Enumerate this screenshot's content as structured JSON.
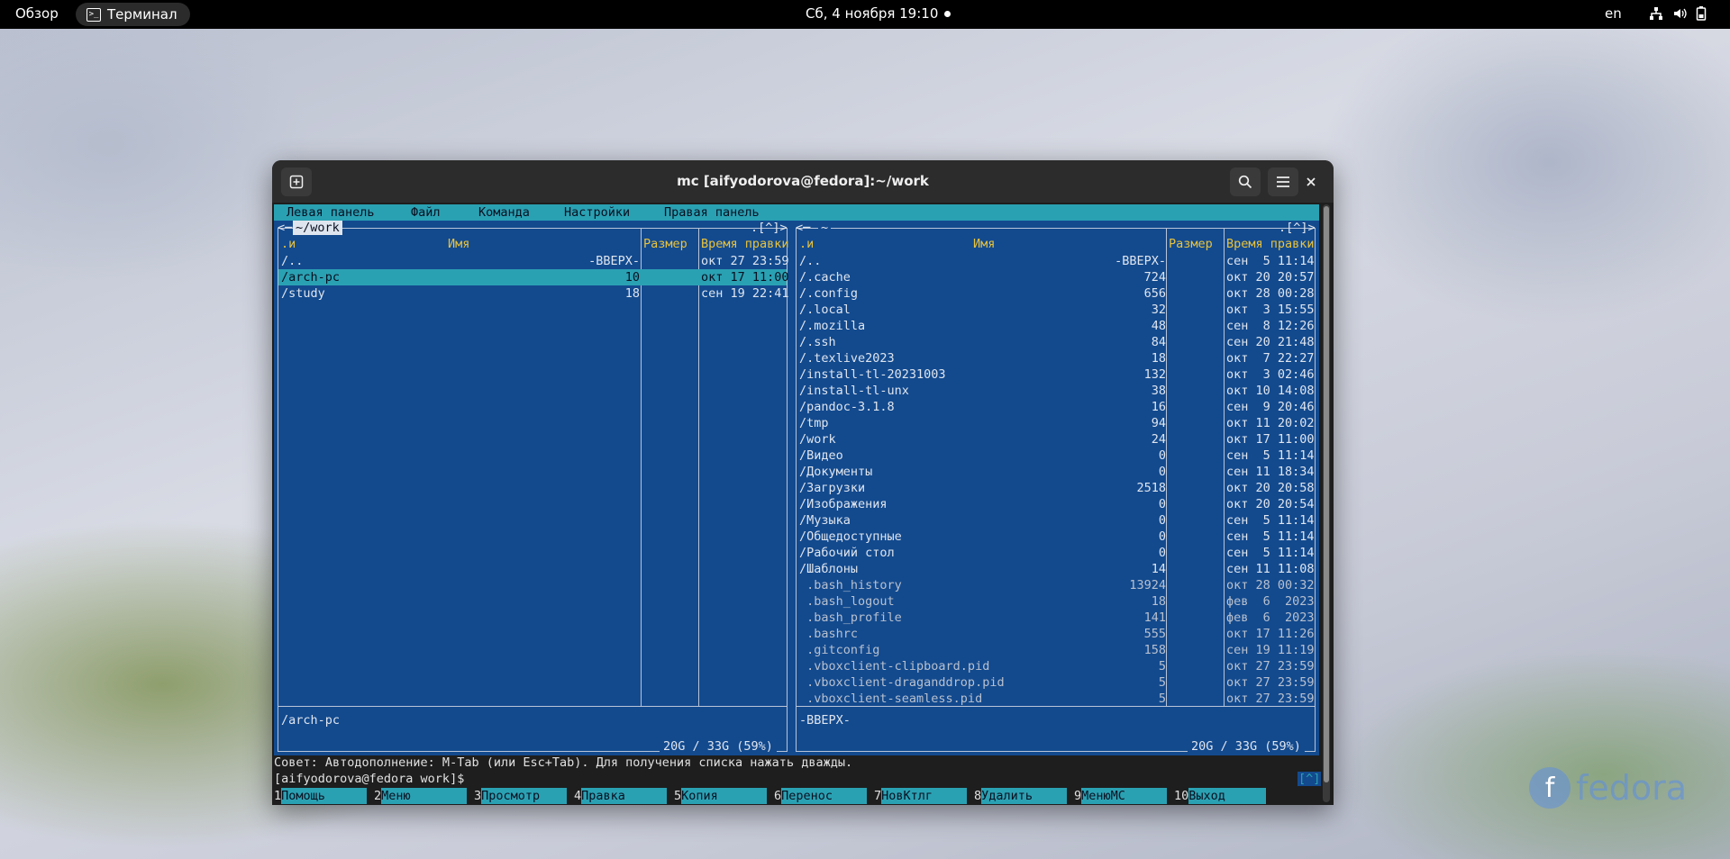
{
  "topbar": {
    "overview": "Обзор",
    "app_name": "Терминал",
    "clock": "Сб, 4 ноября  19:10",
    "lang": "en"
  },
  "window": {
    "title": "mc [aifyodorova@fedora]:~/work"
  },
  "mc": {
    "menu": [
      "Левая панель",
      "Файл",
      "Команда",
      "Настройки",
      "Правая панель"
    ],
    "left": {
      "path": "~/work",
      "corner": ".[^]>",
      "col_n": ".и",
      "col_name": "Имя",
      "col_size": "Размер",
      "col_time": "Время правки",
      "rows": [
        {
          "name": "/..",
          "size": "-ВВЕРХ-",
          "time": "окт 27 23:59"
        },
        {
          "name": "/arch-pc",
          "size": "10",
          "time": "окт 17 11:00"
        },
        {
          "name": "/study",
          "size": "18",
          "time": "сен 19 22:41"
        }
      ],
      "mini": "/arch-pc",
      "disk": "20G / 33G (59%)"
    },
    "right": {
      "path": "~",
      "corner": ".[^]>",
      "col_n": ".и",
      "col_name": "Имя",
      "col_size": "Размер",
      "col_time": "Время правки",
      "rows": [
        {
          "name": "/..",
          "size": "-ВВЕРХ-",
          "time": "сен  5 11:14"
        },
        {
          "name": "/.cache",
          "size": "724",
          "time": "окт 20 20:57"
        },
        {
          "name": "/.config",
          "size": "656",
          "time": "окт 28 00:28"
        },
        {
          "name": "/.local",
          "size": "32",
          "time": "окт  3 15:55"
        },
        {
          "name": "/.mozilla",
          "size": "48",
          "time": "сен  8 12:26"
        },
        {
          "name": "/.ssh",
          "size": "84",
          "time": "сен 20 21:48"
        },
        {
          "name": "/.texlive2023",
          "size": "18",
          "time": "окт  7 22:27"
        },
        {
          "name": "/install-tl-20231003",
          "size": "132",
          "time": "окт  3 02:46"
        },
        {
          "name": "/install-tl-unx",
          "size": "38",
          "time": "окт 10 14:08"
        },
        {
          "name": "/pandoc-3.1.8",
          "size": "16",
          "time": "сен  9 20:46"
        },
        {
          "name": "/tmp",
          "size": "94",
          "time": "окт 11 20:02"
        },
        {
          "name": "/work",
          "size": "24",
          "time": "окт 17 11:00"
        },
        {
          "name": "/Видео",
          "size": "0",
          "time": "сен  5 11:14"
        },
        {
          "name": "/Документы",
          "size": "0",
          "time": "сен 11 18:34"
        },
        {
          "name": "/Загрузки",
          "size": "2518",
          "time": "окт 20 20:58"
        },
        {
          "name": "/Изображения",
          "size": "0",
          "time": "окт 20 20:54"
        },
        {
          "name": "/Музыка",
          "size": "0",
          "time": "сен  5 11:14"
        },
        {
          "name": "/Общедоступные",
          "size": "0",
          "time": "сен  5 11:14"
        },
        {
          "name": "/Рабочий стол",
          "size": "0",
          "time": "сен  5 11:14"
        },
        {
          "name": "/Шаблоны",
          "size": "14",
          "time": "сен 11 11:08"
        },
        {
          "name": " .bash_history",
          "size": "13924",
          "time": "окт 28 00:32"
        },
        {
          "name": " .bash_logout",
          "size": "18",
          "time": "фев  6  2023"
        },
        {
          "name": " .bash_profile",
          "size": "141",
          "time": "фев  6  2023"
        },
        {
          "name": " .bashrc",
          "size": "555",
          "time": "окт 17 11:26"
        },
        {
          "name": " .gitconfig",
          "size": "158",
          "time": "сен 19 11:19"
        },
        {
          "name": " .vboxclient-clipboard.pid",
          "size": "5",
          "time": "окт 27 23:59"
        },
        {
          "name": " .vboxclient-draganddrop.pid",
          "size": "5",
          "time": "окт 27 23:59"
        },
        {
          "name": " .vboxclient-seamless.pid",
          "size": "5",
          "time": "окт 27 23:59"
        }
      ],
      "mini": "-ВВЕРХ-",
      "disk": "20G / 33G (59%)"
    },
    "hint": "Совет: Автодополнение: M-Tab (или Esc+Tab). Для получения списка нажать дважды.",
    "prompt": "[aifyodorova@fedora work]$",
    "caret": "[^]",
    "fkeys": [
      {
        "num": "1",
        "label": "Помощь"
      },
      {
        "num": "2",
        "label": "Меню"
      },
      {
        "num": "3",
        "label": "Просмотр"
      },
      {
        "num": "4",
        "label": "Правка"
      },
      {
        "num": "5",
        "label": "Копия"
      },
      {
        "num": "6",
        "label": "Перенос"
      },
      {
        "num": "7",
        "label": "НовКтлг"
      },
      {
        "num": "8",
        "label": "Удалить"
      },
      {
        "num": "9",
        "label": "МенюМС"
      },
      {
        "num": "10",
        "label": "Выход"
      }
    ]
  },
  "watermark": {
    "text": "fedora",
    "icon": "fedora-logo-icon"
  }
}
